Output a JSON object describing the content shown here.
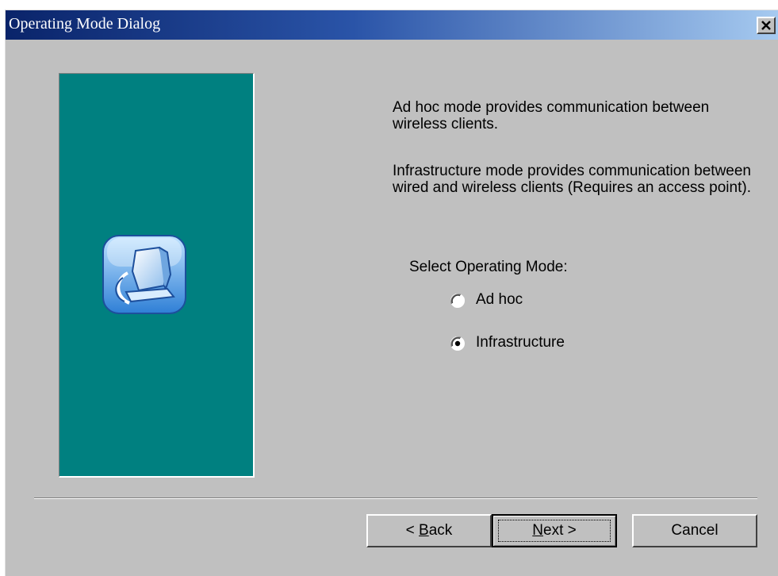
{
  "window": {
    "title": "Operating Mode Dialog"
  },
  "content": {
    "adhoc_description": "Ad hoc mode provides communication between wireless clients.",
    "infrastructure_description": "Infrastructure mode provides communication between wired and wireless clients (Requires an access point).",
    "select_label": "Select Operating Mode:",
    "options": [
      {
        "label": "Ad hoc",
        "selected": false
      },
      {
        "label": "Infrastructure",
        "selected": true
      }
    ]
  },
  "buttons": {
    "back_prefix": "< ",
    "back_mnemonic": "B",
    "back_rest": "ack",
    "next_mnemonic": "N",
    "next_rest": "ext >",
    "cancel": "Cancel"
  },
  "icons": {
    "close": "close-icon",
    "side": "network-computer-icon"
  },
  "colors": {
    "title_start": "#0a246a",
    "title_end": "#a6caf0",
    "panel": "#008080",
    "face": "#c0c0c0"
  }
}
